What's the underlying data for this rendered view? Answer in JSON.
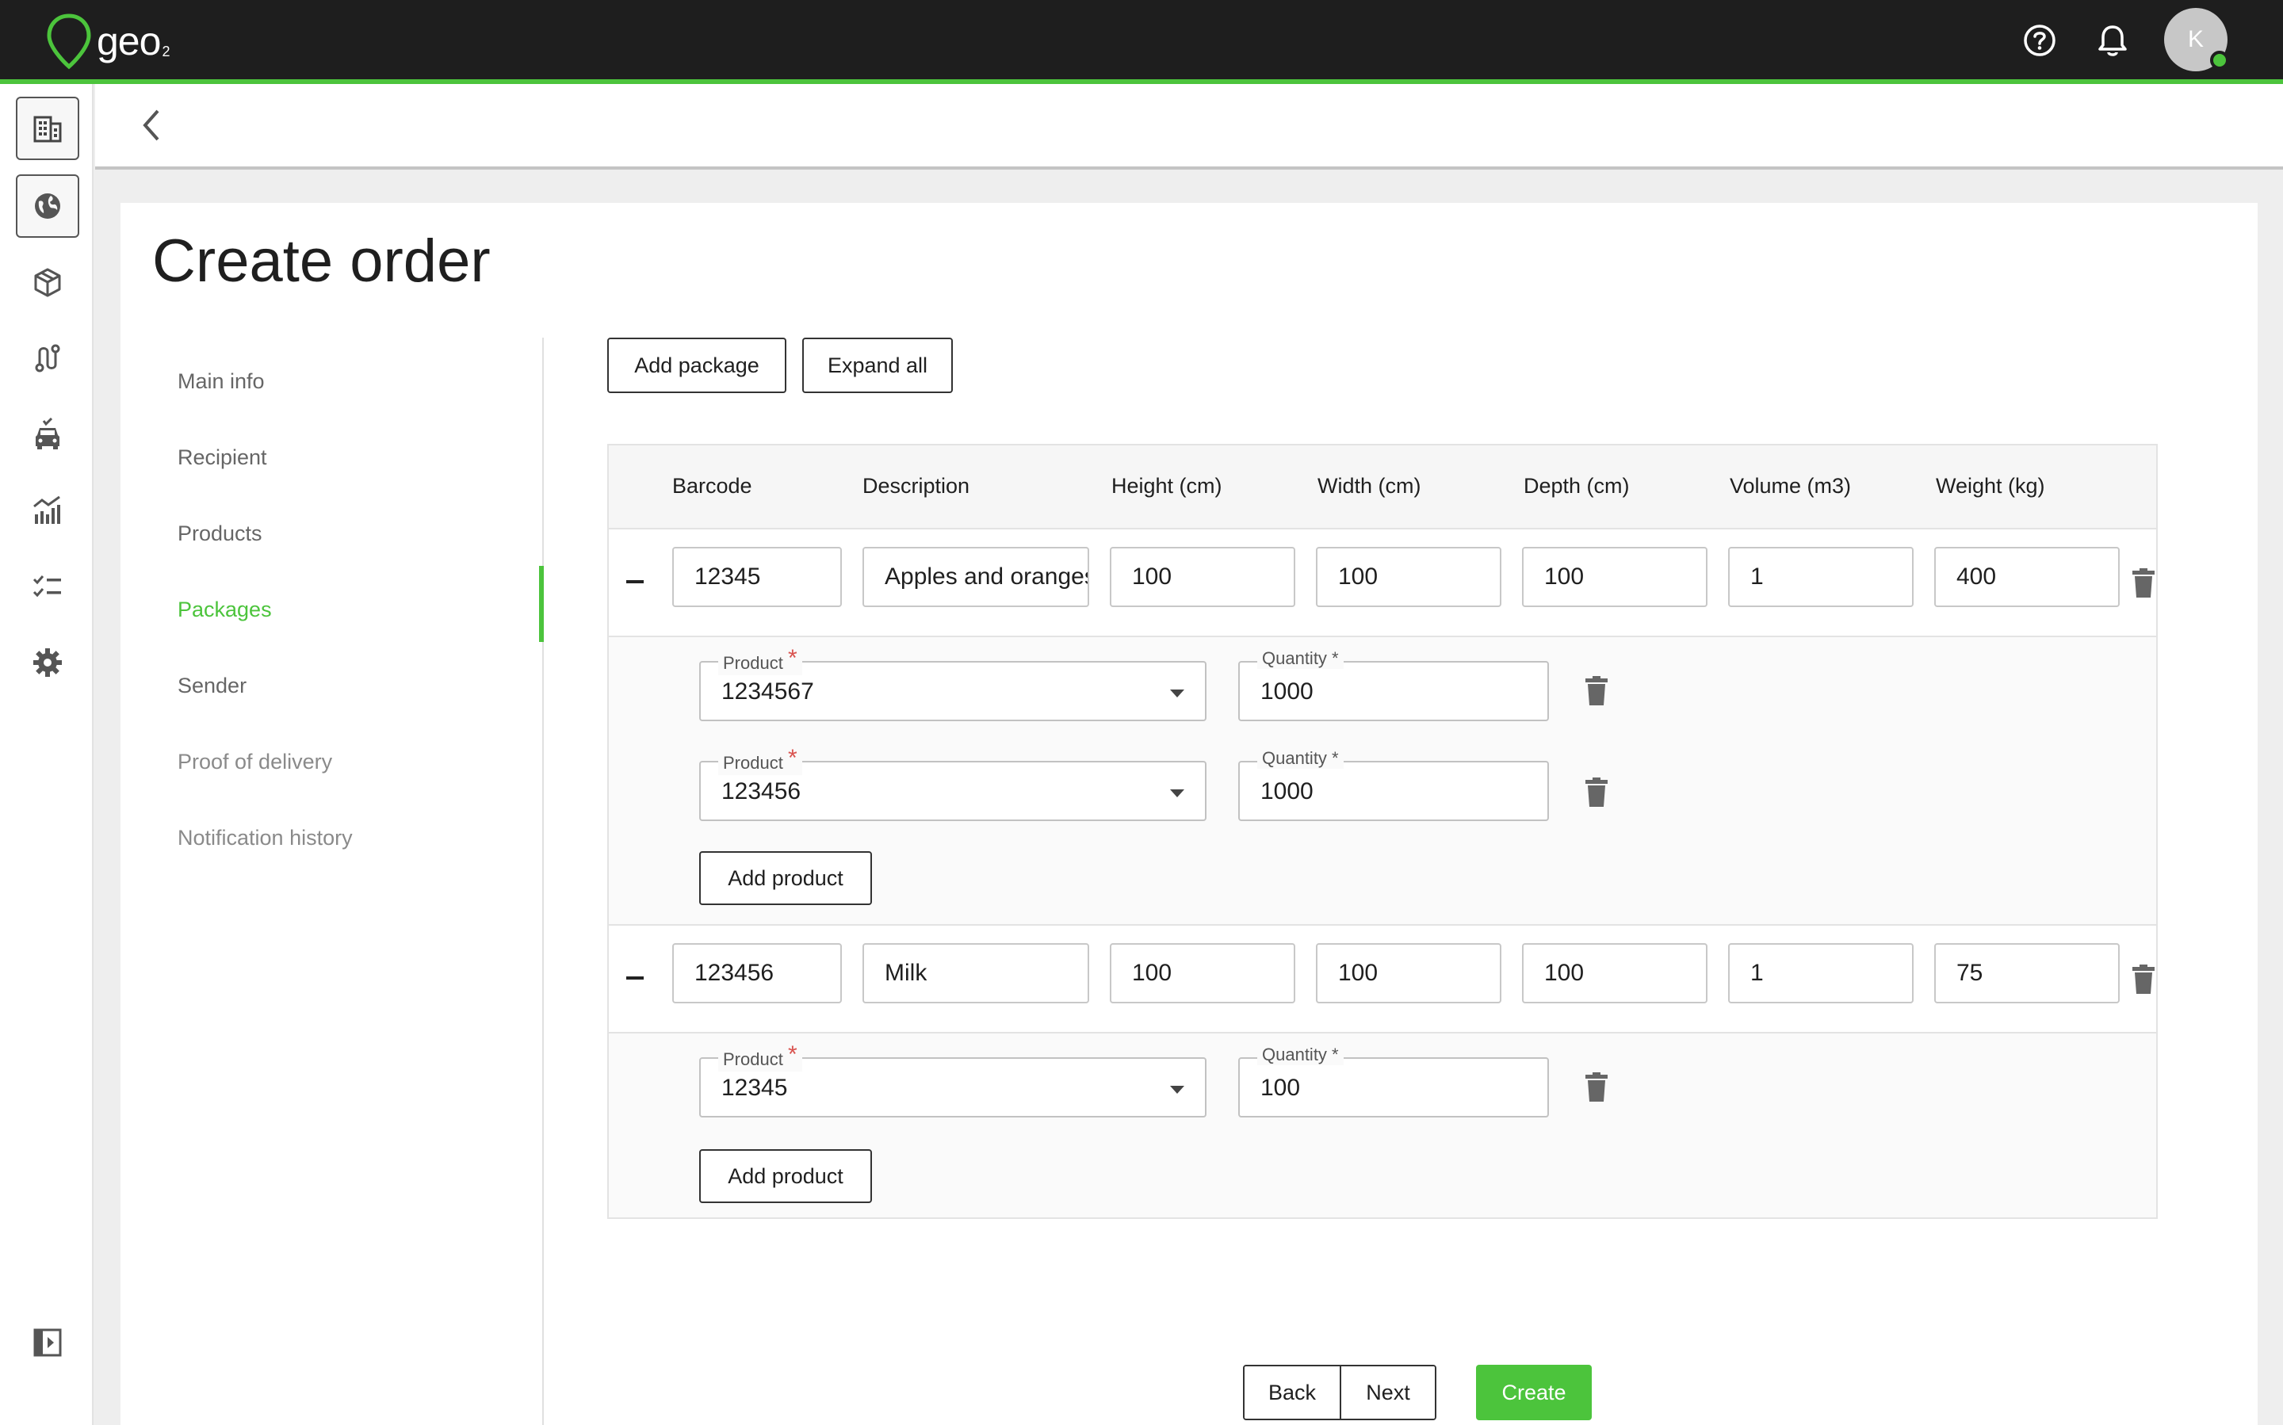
{
  "brand": {
    "name": "geo",
    "subscript": "2",
    "accent_color": "#4cc43c",
    "topbar_color": "#1e1e1e"
  },
  "topbar": {
    "help_icon": "help-circle-icon",
    "notifications_icon": "bell-icon",
    "avatar_initial": "K",
    "avatar_status_color": "#4cc43c"
  },
  "rail": {
    "items": [
      {
        "icon": "building-icon",
        "name": "rail-item-organizations"
      },
      {
        "icon": "globe-icon",
        "name": "rail-item-map"
      },
      {
        "icon": "package-icon",
        "name": "rail-item-orders"
      },
      {
        "icon": "route-icon",
        "name": "rail-item-routes"
      },
      {
        "icon": "vehicle-icon",
        "name": "rail-item-vehicles"
      },
      {
        "icon": "analytics-icon",
        "name": "rail-item-analytics"
      },
      {
        "icon": "checklist-icon",
        "name": "rail-item-tasks"
      },
      {
        "icon": "gear-icon",
        "name": "rail-item-settings"
      }
    ],
    "collapse_icon": "sidebar-toggle-icon"
  },
  "page": {
    "title": "Create order"
  },
  "subnav": {
    "items": [
      {
        "label": "Main info",
        "state": "default"
      },
      {
        "label": "Recipient",
        "state": "default"
      },
      {
        "label": "Products",
        "state": "default"
      },
      {
        "label": "Packages",
        "state": "active"
      },
      {
        "label": "Sender",
        "state": "default"
      },
      {
        "label": "Proof of delivery",
        "state": "muted"
      },
      {
        "label": "Notification history",
        "state": "muted"
      }
    ]
  },
  "toolbar": {
    "add_package": "Add package",
    "expand_all": "Expand all"
  },
  "table": {
    "columns": [
      "Barcode",
      "Description",
      "Height (cm)",
      "Width (cm)",
      "Depth (cm)",
      "Volume (m3)",
      "Weight (kg)"
    ],
    "packages": [
      {
        "barcode": "12345",
        "description": "Apples and oranges",
        "height": "100",
        "width": "100",
        "depth": "100",
        "volume": "1",
        "weight": "400",
        "products": [
          {
            "product_label": "Product",
            "product": "1234567",
            "quantity_label": "Quantity *",
            "quantity": "1000"
          },
          {
            "product_label": "Product",
            "product": "123456",
            "quantity_label": "Quantity *",
            "quantity": "1000"
          }
        ],
        "add_product_label": "Add product"
      },
      {
        "barcode": "123456",
        "description": "Milk",
        "height": "100",
        "width": "100",
        "depth": "100",
        "volume": "1",
        "weight": "75",
        "products": [
          {
            "product_label": "Product",
            "product": "12345",
            "quantity_label": "Quantity *",
            "quantity": "100"
          }
        ],
        "add_product_label": "Add product"
      }
    ]
  },
  "actions": {
    "back": "Back",
    "next": "Next",
    "create": "Create"
  }
}
